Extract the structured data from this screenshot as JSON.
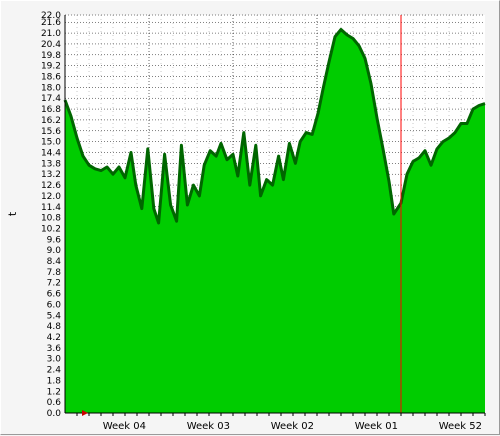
{
  "chart_data": {
    "type": "area",
    "title": "",
    "ylabel": "t",
    "xlabel": "",
    "ylim": [
      0,
      22
    ],
    "y_ticks": [
      "0.0",
      "0.6",
      "1.2",
      "1.8",
      "2.4",
      "3.0",
      "3.6",
      "4.2",
      "4.8",
      "5.4",
      "6.0",
      "6.6",
      "7.2",
      "7.8",
      "8.4",
      "9.0",
      "9.6",
      "10.2",
      "10.8",
      "11.4",
      "12.0",
      "12.6",
      "13.2",
      "13.8",
      "14.4",
      "15.0",
      "15.6",
      "16.2",
      "16.8",
      "17.4",
      "18.0",
      "18.6",
      "19.2",
      "19.8",
      "20.4",
      "21.0",
      "21.6",
      "22.0"
    ],
    "x_ticks": [
      "Week 04",
      "Week 03",
      "Week 02",
      "Week 01",
      "Week 52"
    ],
    "grid": true,
    "x_range_days": [
      0,
      35
    ],
    "current_time_marker_day": 28,
    "series": [
      {
        "color": "#00cc00",
        "outline_color": "#006600",
        "points": [
          [
            0.0,
            17.3
          ],
          [
            0.5,
            16.4
          ],
          [
            1.0,
            15.2
          ],
          [
            1.5,
            14.2
          ],
          [
            2.0,
            13.7
          ],
          [
            2.5,
            13.5
          ],
          [
            3.0,
            13.4
          ],
          [
            3.5,
            13.6
          ],
          [
            4.0,
            13.2
          ],
          [
            4.5,
            13.6
          ],
          [
            5.0,
            13.0
          ],
          [
            5.5,
            14.4
          ],
          [
            5.9,
            12.6
          ],
          [
            6.4,
            11.3
          ],
          [
            6.9,
            14.6
          ],
          [
            7.4,
            11.3
          ],
          [
            7.8,
            10.5
          ],
          [
            8.3,
            14.3
          ],
          [
            8.8,
            11.5
          ],
          [
            9.3,
            10.6
          ],
          [
            9.7,
            14.8
          ],
          [
            10.2,
            11.5
          ],
          [
            10.7,
            12.6
          ],
          [
            11.2,
            12.0
          ],
          [
            11.6,
            13.7
          ],
          [
            12.1,
            14.5
          ],
          [
            12.6,
            14.2
          ],
          [
            13.0,
            14.9
          ],
          [
            13.5,
            14.0
          ],
          [
            14.0,
            14.3
          ],
          [
            14.4,
            13.1
          ],
          [
            14.9,
            15.5
          ],
          [
            15.4,
            12.6
          ],
          [
            15.9,
            14.8
          ],
          [
            16.3,
            12.0
          ],
          [
            16.8,
            12.9
          ],
          [
            17.3,
            12.6
          ],
          [
            17.8,
            14.2
          ],
          [
            18.2,
            12.9
          ],
          [
            18.7,
            14.9
          ],
          [
            19.2,
            13.8
          ],
          [
            19.6,
            15.0
          ],
          [
            20.1,
            15.5
          ],
          [
            20.6,
            15.4
          ],
          [
            21.1,
            16.6
          ],
          [
            21.5,
            17.9
          ],
          [
            22.0,
            19.4
          ],
          [
            22.5,
            20.8
          ],
          [
            23.0,
            21.2
          ],
          [
            23.5,
            20.9
          ],
          [
            24.0,
            20.7
          ],
          [
            24.5,
            20.3
          ],
          [
            25.0,
            19.6
          ],
          [
            25.5,
            18.2
          ],
          [
            26.0,
            16.3
          ],
          [
            26.5,
            14.6
          ],
          [
            27.0,
            12.8
          ],
          [
            27.4,
            11.0
          ],
          [
            28.0,
            11.6
          ],
          [
            28.5,
            13.2
          ],
          [
            29.0,
            13.9
          ],
          [
            29.5,
            14.1
          ],
          [
            30.0,
            14.5
          ],
          [
            30.5,
            13.7
          ],
          [
            31.0,
            14.6
          ],
          [
            31.5,
            15.0
          ],
          [
            32.0,
            15.2
          ],
          [
            32.5,
            15.5
          ],
          [
            33.0,
            16.0
          ],
          [
            33.5,
            16.0
          ],
          [
            34.0,
            16.8
          ],
          [
            34.5,
            17.0
          ],
          [
            35.0,
            17.1
          ]
        ]
      }
    ]
  }
}
